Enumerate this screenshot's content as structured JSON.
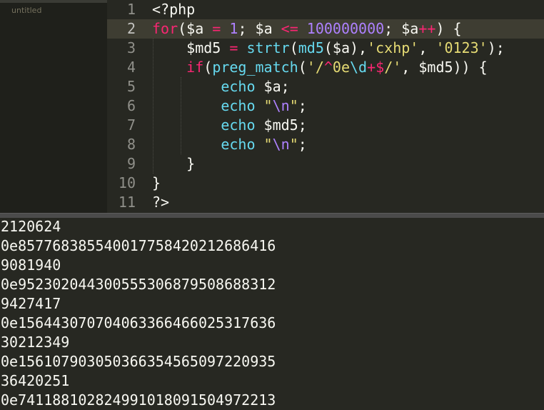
{
  "sidebar": {
    "file_name": "untitled"
  },
  "editor": {
    "active_line": 2,
    "lines": [
      {
        "num": "1",
        "tokens": [
          {
            "t": "<?php",
            "c": "w"
          }
        ]
      },
      {
        "num": "2",
        "tokens": [
          {
            "t": "for",
            "c": "k"
          },
          {
            "t": "(",
            "c": "w"
          },
          {
            "t": "$a",
            "c": "w"
          },
          {
            "t": " = ",
            "c": "k"
          },
          {
            "t": "1",
            "c": "n"
          },
          {
            "t": "; ",
            "c": "w"
          },
          {
            "t": "$a",
            "c": "w"
          },
          {
            "t": " <= ",
            "c": "k"
          },
          {
            "t": "100000000",
            "c": "n"
          },
          {
            "t": "; ",
            "c": "w"
          },
          {
            "t": "$a",
            "c": "w"
          },
          {
            "t": "++",
            "c": "k"
          },
          {
            "t": ") {",
            "c": "w"
          }
        ]
      },
      {
        "num": "3",
        "tokens": [
          {
            "t": "    ",
            "c": "w"
          },
          {
            "t": "$md5",
            "c": "w"
          },
          {
            "t": " = ",
            "c": "k"
          },
          {
            "t": "strtr",
            "c": "f"
          },
          {
            "t": "(",
            "c": "w"
          },
          {
            "t": "md5",
            "c": "f"
          },
          {
            "t": "(",
            "c": "w"
          },
          {
            "t": "$a",
            "c": "w"
          },
          {
            "t": "),",
            "c": "w"
          },
          {
            "t": "'cxhp'",
            "c": "s"
          },
          {
            "t": ", ",
            "c": "w"
          },
          {
            "t": "'0123'",
            "c": "s"
          },
          {
            "t": ");",
            "c": "w"
          }
        ]
      },
      {
        "num": "4",
        "tokens": [
          {
            "t": "    ",
            "c": "w"
          },
          {
            "t": "if",
            "c": "k"
          },
          {
            "t": "(",
            "c": "w"
          },
          {
            "t": "preg_match",
            "c": "f"
          },
          {
            "t": "(",
            "c": "w"
          },
          {
            "t": "'/",
            "c": "s"
          },
          {
            "t": "^",
            "c": "k"
          },
          {
            "t": "0e",
            "c": "s"
          },
          {
            "t": "\\d",
            "c": "f"
          },
          {
            "t": "+$",
            "c": "k"
          },
          {
            "t": "/'",
            "c": "s"
          },
          {
            "t": ", ",
            "c": "w"
          },
          {
            "t": "$md5",
            "c": "w"
          },
          {
            "t": ")) {",
            "c": "w"
          }
        ]
      },
      {
        "num": "5",
        "tokens": [
          {
            "t": "        ",
            "c": "w"
          },
          {
            "t": "echo",
            "c": "f"
          },
          {
            "t": " $a;",
            "c": "w"
          }
        ]
      },
      {
        "num": "6",
        "tokens": [
          {
            "t": "        ",
            "c": "w"
          },
          {
            "t": "echo",
            "c": "f"
          },
          {
            "t": " ",
            "c": "w"
          },
          {
            "t": "\"",
            "c": "s"
          },
          {
            "t": "\\n",
            "c": "n"
          },
          {
            "t": "\"",
            "c": "s"
          },
          {
            "t": ";",
            "c": "w"
          }
        ]
      },
      {
        "num": "7",
        "tokens": [
          {
            "t": "        ",
            "c": "w"
          },
          {
            "t": "echo",
            "c": "f"
          },
          {
            "t": " $md5;",
            "c": "w"
          }
        ]
      },
      {
        "num": "8",
        "tokens": [
          {
            "t": "        ",
            "c": "w"
          },
          {
            "t": "echo",
            "c": "f"
          },
          {
            "t": " ",
            "c": "w"
          },
          {
            "t": "\"",
            "c": "s"
          },
          {
            "t": "\\n",
            "c": "n"
          },
          {
            "t": "\"",
            "c": "s"
          },
          {
            "t": ";",
            "c": "w"
          }
        ]
      },
      {
        "num": "9",
        "tokens": [
          {
            "t": "    }",
            "c": "w"
          }
        ]
      },
      {
        "num": "10",
        "tokens": [
          {
            "t": "}",
            "c": "w"
          }
        ]
      },
      {
        "num": "11",
        "tokens": [
          {
            "t": "?>",
            "c": "w"
          }
        ]
      }
    ]
  },
  "output": {
    "lines": [
      "2120624",
      "0e857768385540017758420212686416",
      "9081940",
      "0e952302044300555306879508688312",
      "9427417",
      "0e156443070704063366466025317636",
      "30212349",
      "0e156107903050366354565097220935",
      "36420251",
      "0e741188102824991018091504972213"
    ]
  },
  "colors": {
    "k": "#f92672",
    "f": "#66d9ef",
    "n": "#ae81ff",
    "s": "#e6db74",
    "w": "#f8f8f2"
  }
}
